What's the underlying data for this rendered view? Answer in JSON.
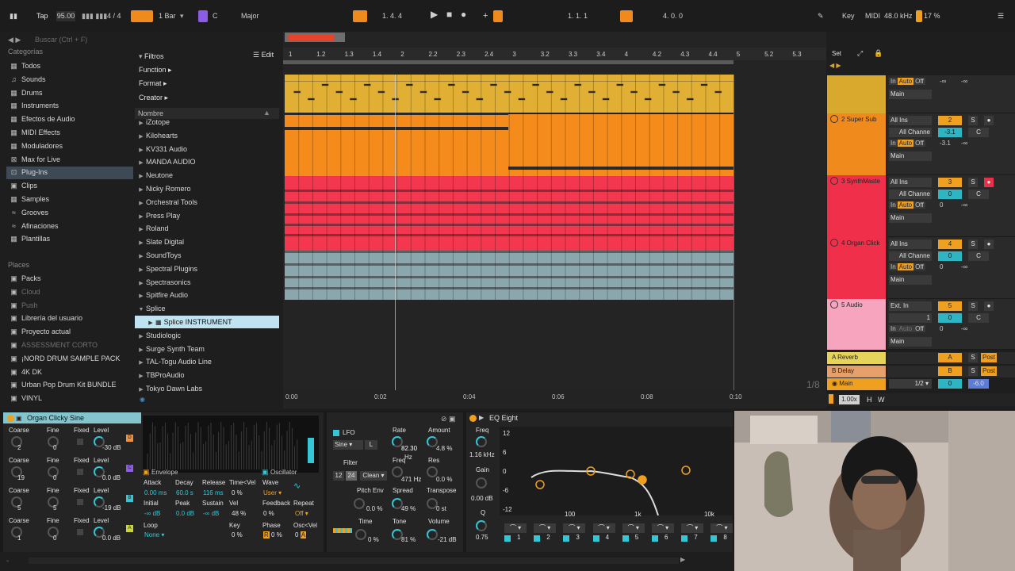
{
  "transport": {
    "tap": "Tap",
    "tempo": "95.00",
    "time_sig": "4 / 4",
    "quantize": "1 Bar",
    "key": "C",
    "scale": "Major",
    "position": "1.   4.   4",
    "loop_start": "1.   1.   1",
    "loop_length": "4.   0.   0",
    "key_label": "Key",
    "midi_label": "MIDI",
    "sample_rate": "48.0 kHz",
    "cpu": "17 %"
  },
  "browser": {
    "search_placeholder": "Buscar (Ctrl + F)",
    "categories_title": "Categorías",
    "categories": [
      {
        "label": "Todos",
        "icon": "all-icon"
      },
      {
        "label": "Sounds",
        "icon": "sounds-icon"
      },
      {
        "label": "Drums",
        "icon": "drums-icon"
      },
      {
        "label": "Instruments",
        "icon": "instruments-icon"
      },
      {
        "label": "Efectos de Audio",
        "icon": "audio-effects-icon"
      },
      {
        "label": "MIDI Effects",
        "icon": "midi-effects-icon"
      },
      {
        "label": "Moduladores",
        "icon": "modulators-icon"
      },
      {
        "label": "Max for Live",
        "icon": "max-for-live-icon"
      },
      {
        "label": "Plug-Ins",
        "icon": "plugins-icon"
      },
      {
        "label": "Clips",
        "icon": "clips-icon"
      },
      {
        "label": "Samples",
        "icon": "samples-icon"
      },
      {
        "label": "Grooves",
        "icon": "grooves-icon"
      },
      {
        "label": "Afinaciones",
        "icon": "tunings-icon"
      },
      {
        "label": "Plantillas",
        "icon": "templates-icon"
      }
    ],
    "places_title": "Places",
    "places": [
      {
        "label": "Packs",
        "dim": false
      },
      {
        "label": "Cloud",
        "dim": true
      },
      {
        "label": "Push",
        "dim": true
      },
      {
        "label": "Librería del usuario",
        "dim": false
      },
      {
        "label": "Proyecto actual",
        "dim": false
      },
      {
        "label": "ASSESSMENT CORTO",
        "dim": true
      },
      {
        "label": "¡NORD DRUM SAMPLE PACK",
        "dim": false
      },
      {
        "label": "4K DK",
        "dim": false
      },
      {
        "label": "Urban Pop Drum Kit BUNDLE",
        "dim": false
      },
      {
        "label": "VINYL",
        "dim": false
      }
    ],
    "filters_label": "Filtros",
    "edit_label": "Edit",
    "filter_items": [
      "Function",
      "Format",
      "Creator"
    ],
    "column_header": "Nombre",
    "libraries": [
      "iZotope",
      "Kilohearts",
      "KV331 Audio",
      "MANDA AUDIO",
      "Neutone",
      "Nicky Romero",
      "Orchestral Tools",
      "Press Play",
      "Roland",
      "Slate Digital",
      "SoundToys",
      "Spectral Plugins",
      "Spectrasonics",
      "Spitfire Audio",
      "Splice",
      "Splice INSTRUMENT",
      "Studiologic",
      "Surge Synth Team",
      "TAL-Togu Audio Line",
      "TBProAudio",
      "Tokyo Dawn Labs"
    ]
  },
  "arrangement": {
    "ruler": [
      "1",
      "1.2",
      "1.3",
      "1.4",
      "2",
      "2.2",
      "2.3",
      "2.4",
      "3",
      "3.2",
      "3.3",
      "3.4",
      "4",
      "4.2",
      "4.3",
      "4.4",
      "5",
      "5.2",
      "5.3"
    ],
    "time_ruler": [
      "0:00",
      "0:02",
      "0:04",
      "0:06",
      "0:08",
      "0:10"
    ],
    "zoom_label": "1/8",
    "set_label": "Set"
  },
  "mixer": {
    "tracks": [
      {
        "name": "",
        "color": "#d9a92e",
        "input": "",
        "channel": "",
        "number": "",
        "vol": "-∞",
        "pan": "-∞",
        "out": "Main"
      },
      {
        "name": "2 Super Sub",
        "color": "#f08a1c",
        "input": "All Ins",
        "channel": "All Channe",
        "number": "2",
        "vol": "-3.1",
        "pan": "C",
        "out": "Main"
      },
      {
        "name": "3 SynthMaste",
        "color": "#f0304a",
        "input": "All Ins",
        "channel": "All Channe",
        "number": "3",
        "vol": "0",
        "pan": "C",
        "out": "Main"
      },
      {
        "name": "4 Organ Click",
        "color": "#f0304a",
        "input": "All Ins",
        "channel": "All Channe",
        "number": "4",
        "vol": "0",
        "pan": "C",
        "out": "Main"
      },
      {
        "name": "5 Audio",
        "color": "#f7a5bf",
        "input": "Ext. In",
        "channel": "1",
        "number": "5",
        "vol": "0",
        "pan": "C",
        "out": "Main"
      }
    ],
    "returns": [
      {
        "name": "A Reverb",
        "letter": "A",
        "color": "#e6d45a"
      },
      {
        "name": "B Delay",
        "letter": "B",
        "color": "#e8a06a"
      }
    ],
    "main": {
      "name": "Main",
      "value": "1/2",
      "vol": "0",
      "out": "-6.0"
    },
    "in_label": "In",
    "auto_label": "Auto",
    "off_label": "Off",
    "s_label": "S",
    "post_label": "Post",
    "zoom": "1.00x",
    "h_label": "H",
    "w_label": "W"
  },
  "organ": {
    "title": "Organ Clicky Sine",
    "rows": [
      {
        "coarse": "Coarse",
        "fine": "Fine",
        "fixed": "Fixed",
        "level": "Level",
        "cv": "2",
        "fv": "0",
        "lv": "-30 dB",
        "tag": "D"
      },
      {
        "coarse": "Coarse",
        "fine": "Fine",
        "fixed": "Fixed",
        "level": "Level",
        "cv": "19",
        "fv": "0",
        "lv": "0.0 dB",
        "tag": "C"
      },
      {
        "coarse": "Coarse",
        "fine": "Fine",
        "fixed": "Fixed",
        "level": "Level",
        "cv": "5",
        "fv": "5",
        "lv": "-19 dB",
        "tag": "B"
      },
      {
        "coarse": "Coarse",
        "fine": "Fine",
        "fixed": "Fixed",
        "level": "Level",
        "cv": "1",
        "fv": "0",
        "lv": "0.0 dB",
        "tag": "A"
      }
    ],
    "envelope_label": "Envelope",
    "oscillator_label": "Oscillator",
    "attack": "Attack",
    "decay": "Decay",
    "release": "Release",
    "time_vel": "Time<Vel",
    "wave": "Wave",
    "attack_v": "0.00 ms",
    "decay_v": "60.0 s",
    "release_v": "116 ms",
    "time_vel_v": "0 %",
    "wave_v": "User",
    "initial": "Initial",
    "peak": "Peak",
    "sustain": "Sustain",
    "vel": "Vel",
    "feedback": "Feedback",
    "repeat": "Repeat",
    "initial_v": "-∞ dB",
    "peak_v": "0.0 dB",
    "sustain_v": "-∞ dB",
    "vel_v": "48 %",
    "feedback_v": "0 %",
    "repeat_v": "Off",
    "loop": "Loop",
    "loop_v": "None",
    "key": "Key",
    "key_v": "0 %",
    "phase": "Phase",
    "phase_v": "0 %",
    "osc_vel": "Osc<Vel",
    "osc_vel_v": "0"
  },
  "lfo": {
    "lfo_label": "LFO",
    "rate": "Rate",
    "amount": "Amount",
    "shape": "Sine",
    "lr": "L",
    "rate_v": "82.30",
    "rate_unit": "Hz",
    "amount_v": "4.8 %",
    "filter": "Filter",
    "freq": "Freq",
    "res": "Res",
    "filter_db1": "12",
    "filter_db2": "24",
    "clean": "Clean",
    "freq_v": "471 Hz",
    "res_v": "0.0 %",
    "pitch_env": "Pitch Env",
    "spread": "Spread",
    "transpose": "Transpose",
    "pitch_env_v": "0.0 %",
    "spread_v": "49 %",
    "transpose_v": "0 st",
    "time": "Time",
    "tone": "Tone",
    "volume": "Volume",
    "time_v": "0 %",
    "tone_v": "81 %",
    "volume_v": "-21 dB"
  },
  "eq": {
    "title": "EQ Eight",
    "freq": "Freq",
    "freq_v": "1.16 kHz",
    "gain": "Gain",
    "gain_v": "0.00 dB",
    "q": "Q",
    "q_v": "0.75",
    "db_labels": [
      "12",
      "6",
      "0",
      "-6",
      "-12"
    ],
    "hz_labels": [
      "100",
      "1k",
      "10k"
    ],
    "bands": [
      "1",
      "2",
      "3",
      "4",
      "5",
      "6",
      "7",
      "8"
    ]
  }
}
